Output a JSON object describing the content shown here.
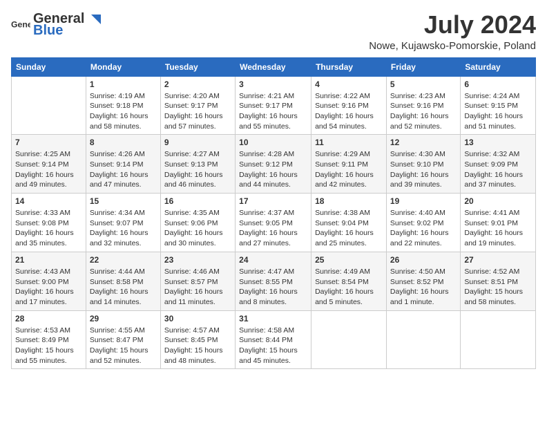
{
  "header": {
    "logo_general": "General",
    "logo_blue": "Blue",
    "title": "July 2024",
    "subtitle": "Nowe, Kujawsko-Pomorskie, Poland"
  },
  "columns": [
    "Sunday",
    "Monday",
    "Tuesday",
    "Wednesday",
    "Thursday",
    "Friday",
    "Saturday"
  ],
  "weeks": [
    [
      {
        "day": "",
        "info": ""
      },
      {
        "day": "1",
        "info": "Sunrise: 4:19 AM\nSunset: 9:18 PM\nDaylight: 16 hours\nand 58 minutes."
      },
      {
        "day": "2",
        "info": "Sunrise: 4:20 AM\nSunset: 9:17 PM\nDaylight: 16 hours\nand 57 minutes."
      },
      {
        "day": "3",
        "info": "Sunrise: 4:21 AM\nSunset: 9:17 PM\nDaylight: 16 hours\nand 55 minutes."
      },
      {
        "day": "4",
        "info": "Sunrise: 4:22 AM\nSunset: 9:16 PM\nDaylight: 16 hours\nand 54 minutes."
      },
      {
        "day": "5",
        "info": "Sunrise: 4:23 AM\nSunset: 9:16 PM\nDaylight: 16 hours\nand 52 minutes."
      },
      {
        "day": "6",
        "info": "Sunrise: 4:24 AM\nSunset: 9:15 PM\nDaylight: 16 hours\nand 51 minutes."
      }
    ],
    [
      {
        "day": "7",
        "info": "Sunrise: 4:25 AM\nSunset: 9:14 PM\nDaylight: 16 hours\nand 49 minutes."
      },
      {
        "day": "8",
        "info": "Sunrise: 4:26 AM\nSunset: 9:14 PM\nDaylight: 16 hours\nand 47 minutes."
      },
      {
        "day": "9",
        "info": "Sunrise: 4:27 AM\nSunset: 9:13 PM\nDaylight: 16 hours\nand 46 minutes."
      },
      {
        "day": "10",
        "info": "Sunrise: 4:28 AM\nSunset: 9:12 PM\nDaylight: 16 hours\nand 44 minutes."
      },
      {
        "day": "11",
        "info": "Sunrise: 4:29 AM\nSunset: 9:11 PM\nDaylight: 16 hours\nand 42 minutes."
      },
      {
        "day": "12",
        "info": "Sunrise: 4:30 AM\nSunset: 9:10 PM\nDaylight: 16 hours\nand 39 minutes."
      },
      {
        "day": "13",
        "info": "Sunrise: 4:32 AM\nSunset: 9:09 PM\nDaylight: 16 hours\nand 37 minutes."
      }
    ],
    [
      {
        "day": "14",
        "info": "Sunrise: 4:33 AM\nSunset: 9:08 PM\nDaylight: 16 hours\nand 35 minutes."
      },
      {
        "day": "15",
        "info": "Sunrise: 4:34 AM\nSunset: 9:07 PM\nDaylight: 16 hours\nand 32 minutes."
      },
      {
        "day": "16",
        "info": "Sunrise: 4:35 AM\nSunset: 9:06 PM\nDaylight: 16 hours\nand 30 minutes."
      },
      {
        "day": "17",
        "info": "Sunrise: 4:37 AM\nSunset: 9:05 PM\nDaylight: 16 hours\nand 27 minutes."
      },
      {
        "day": "18",
        "info": "Sunrise: 4:38 AM\nSunset: 9:04 PM\nDaylight: 16 hours\nand 25 minutes."
      },
      {
        "day": "19",
        "info": "Sunrise: 4:40 AM\nSunset: 9:02 PM\nDaylight: 16 hours\nand 22 minutes."
      },
      {
        "day": "20",
        "info": "Sunrise: 4:41 AM\nSunset: 9:01 PM\nDaylight: 16 hours\nand 19 minutes."
      }
    ],
    [
      {
        "day": "21",
        "info": "Sunrise: 4:43 AM\nSunset: 9:00 PM\nDaylight: 16 hours\nand 17 minutes."
      },
      {
        "day": "22",
        "info": "Sunrise: 4:44 AM\nSunset: 8:58 PM\nDaylight: 16 hours\nand 14 minutes."
      },
      {
        "day": "23",
        "info": "Sunrise: 4:46 AM\nSunset: 8:57 PM\nDaylight: 16 hours\nand 11 minutes."
      },
      {
        "day": "24",
        "info": "Sunrise: 4:47 AM\nSunset: 8:55 PM\nDaylight: 16 hours\nand 8 minutes."
      },
      {
        "day": "25",
        "info": "Sunrise: 4:49 AM\nSunset: 8:54 PM\nDaylight: 16 hours\nand 5 minutes."
      },
      {
        "day": "26",
        "info": "Sunrise: 4:50 AM\nSunset: 8:52 PM\nDaylight: 16 hours\nand 1 minute."
      },
      {
        "day": "27",
        "info": "Sunrise: 4:52 AM\nSunset: 8:51 PM\nDaylight: 15 hours\nand 58 minutes."
      }
    ],
    [
      {
        "day": "28",
        "info": "Sunrise: 4:53 AM\nSunset: 8:49 PM\nDaylight: 15 hours\nand 55 minutes."
      },
      {
        "day": "29",
        "info": "Sunrise: 4:55 AM\nSunset: 8:47 PM\nDaylight: 15 hours\nand 52 minutes."
      },
      {
        "day": "30",
        "info": "Sunrise: 4:57 AM\nSunset: 8:45 PM\nDaylight: 15 hours\nand 48 minutes."
      },
      {
        "day": "31",
        "info": "Sunrise: 4:58 AM\nSunset: 8:44 PM\nDaylight: 15 hours\nand 45 minutes."
      },
      {
        "day": "",
        "info": ""
      },
      {
        "day": "",
        "info": ""
      },
      {
        "day": "",
        "info": ""
      }
    ]
  ]
}
